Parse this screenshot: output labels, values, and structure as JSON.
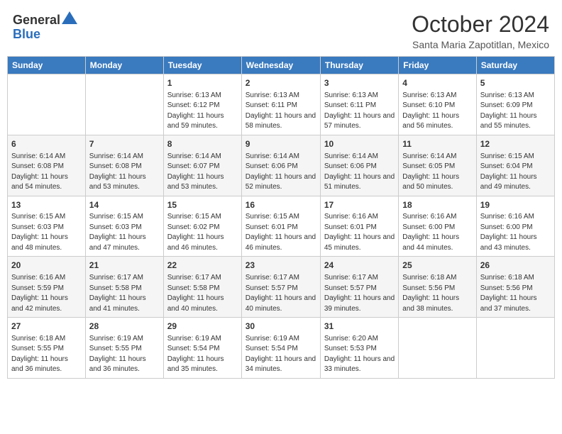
{
  "logo": {
    "general": "General",
    "blue": "Blue"
  },
  "title": "October 2024",
  "subtitle": "Santa Maria Zapotitlan, Mexico",
  "days_of_week": [
    "Sunday",
    "Monday",
    "Tuesday",
    "Wednesday",
    "Thursday",
    "Friday",
    "Saturday"
  ],
  "weeks": [
    [
      {
        "day": "",
        "info": ""
      },
      {
        "day": "",
        "info": ""
      },
      {
        "day": "1",
        "info": "Sunrise: 6:13 AM\nSunset: 6:12 PM\nDaylight: 11 hours and 59 minutes."
      },
      {
        "day": "2",
        "info": "Sunrise: 6:13 AM\nSunset: 6:11 PM\nDaylight: 11 hours and 58 minutes."
      },
      {
        "day": "3",
        "info": "Sunrise: 6:13 AM\nSunset: 6:11 PM\nDaylight: 11 hours and 57 minutes."
      },
      {
        "day": "4",
        "info": "Sunrise: 6:13 AM\nSunset: 6:10 PM\nDaylight: 11 hours and 56 minutes."
      },
      {
        "day": "5",
        "info": "Sunrise: 6:13 AM\nSunset: 6:09 PM\nDaylight: 11 hours and 55 minutes."
      }
    ],
    [
      {
        "day": "6",
        "info": "Sunrise: 6:14 AM\nSunset: 6:08 PM\nDaylight: 11 hours and 54 minutes."
      },
      {
        "day": "7",
        "info": "Sunrise: 6:14 AM\nSunset: 6:08 PM\nDaylight: 11 hours and 53 minutes."
      },
      {
        "day": "8",
        "info": "Sunrise: 6:14 AM\nSunset: 6:07 PM\nDaylight: 11 hours and 53 minutes."
      },
      {
        "day": "9",
        "info": "Sunrise: 6:14 AM\nSunset: 6:06 PM\nDaylight: 11 hours and 52 minutes."
      },
      {
        "day": "10",
        "info": "Sunrise: 6:14 AM\nSunset: 6:06 PM\nDaylight: 11 hours and 51 minutes."
      },
      {
        "day": "11",
        "info": "Sunrise: 6:14 AM\nSunset: 6:05 PM\nDaylight: 11 hours and 50 minutes."
      },
      {
        "day": "12",
        "info": "Sunrise: 6:15 AM\nSunset: 6:04 PM\nDaylight: 11 hours and 49 minutes."
      }
    ],
    [
      {
        "day": "13",
        "info": "Sunrise: 6:15 AM\nSunset: 6:03 PM\nDaylight: 11 hours and 48 minutes."
      },
      {
        "day": "14",
        "info": "Sunrise: 6:15 AM\nSunset: 6:03 PM\nDaylight: 11 hours and 47 minutes."
      },
      {
        "day": "15",
        "info": "Sunrise: 6:15 AM\nSunset: 6:02 PM\nDaylight: 11 hours and 46 minutes."
      },
      {
        "day": "16",
        "info": "Sunrise: 6:15 AM\nSunset: 6:01 PM\nDaylight: 11 hours and 46 minutes."
      },
      {
        "day": "17",
        "info": "Sunrise: 6:16 AM\nSunset: 6:01 PM\nDaylight: 11 hours and 45 minutes."
      },
      {
        "day": "18",
        "info": "Sunrise: 6:16 AM\nSunset: 6:00 PM\nDaylight: 11 hours and 44 minutes."
      },
      {
        "day": "19",
        "info": "Sunrise: 6:16 AM\nSunset: 6:00 PM\nDaylight: 11 hours and 43 minutes."
      }
    ],
    [
      {
        "day": "20",
        "info": "Sunrise: 6:16 AM\nSunset: 5:59 PM\nDaylight: 11 hours and 42 minutes."
      },
      {
        "day": "21",
        "info": "Sunrise: 6:17 AM\nSunset: 5:58 PM\nDaylight: 11 hours and 41 minutes."
      },
      {
        "day": "22",
        "info": "Sunrise: 6:17 AM\nSunset: 5:58 PM\nDaylight: 11 hours and 40 minutes."
      },
      {
        "day": "23",
        "info": "Sunrise: 6:17 AM\nSunset: 5:57 PM\nDaylight: 11 hours and 40 minutes."
      },
      {
        "day": "24",
        "info": "Sunrise: 6:17 AM\nSunset: 5:57 PM\nDaylight: 11 hours and 39 minutes."
      },
      {
        "day": "25",
        "info": "Sunrise: 6:18 AM\nSunset: 5:56 PM\nDaylight: 11 hours and 38 minutes."
      },
      {
        "day": "26",
        "info": "Sunrise: 6:18 AM\nSunset: 5:56 PM\nDaylight: 11 hours and 37 minutes."
      }
    ],
    [
      {
        "day": "27",
        "info": "Sunrise: 6:18 AM\nSunset: 5:55 PM\nDaylight: 11 hours and 36 minutes."
      },
      {
        "day": "28",
        "info": "Sunrise: 6:19 AM\nSunset: 5:55 PM\nDaylight: 11 hours and 36 minutes."
      },
      {
        "day": "29",
        "info": "Sunrise: 6:19 AM\nSunset: 5:54 PM\nDaylight: 11 hours and 35 minutes."
      },
      {
        "day": "30",
        "info": "Sunrise: 6:19 AM\nSunset: 5:54 PM\nDaylight: 11 hours and 34 minutes."
      },
      {
        "day": "31",
        "info": "Sunrise: 6:20 AM\nSunset: 5:53 PM\nDaylight: 11 hours and 33 minutes."
      },
      {
        "day": "",
        "info": ""
      },
      {
        "day": "",
        "info": ""
      }
    ]
  ]
}
